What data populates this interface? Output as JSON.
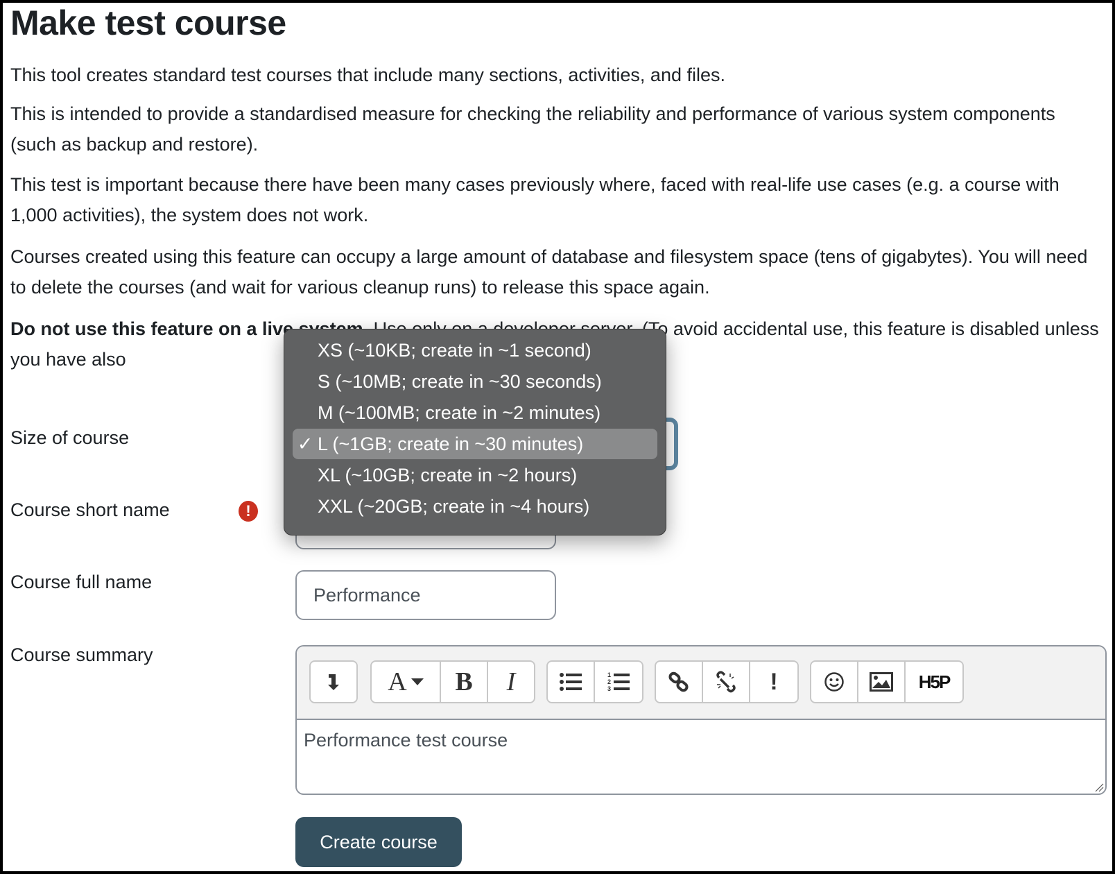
{
  "page": {
    "title": "Make test course",
    "paragraphs": [
      "This tool creates standard test courses that include many sections, activities, and files.",
      "This is intended to provide a standardised measure for checking the reliability and performance of various system components (such as backup and restore).",
      "This test is important because there have been many cases previously where, faced with real-life use cases (e.g. a course with 1,000 activities), the system does not work.",
      "Courses created using this feature can occupy a large amount of database and filesystem space (tens of gigabytes). You will need to delete the courses (and wait for various cleanup runs) to release this space again."
    ],
    "warning_bold": "Do not use this feature on a live system.",
    "warning_rest": " Use only on a developer server. (To avoid accidental use, this feature is disabled unless you have also"
  },
  "form": {
    "size_label": "Size of course",
    "size_selected": "L (~1GB; create in ~30 minutes)",
    "size_options": [
      {
        "label": "XS (~10KB; create in ~1 second)",
        "selected": false
      },
      {
        "label": "S (~10MB; create in ~30 seconds)",
        "selected": false
      },
      {
        "label": "M (~100MB; create in ~2 minutes)",
        "selected": false
      },
      {
        "label": "L (~1GB; create in ~30 minutes)",
        "selected": true
      },
      {
        "label": "XL (~10GB; create in ~2 hours)",
        "selected": false
      },
      {
        "label": "XXL (~20GB; create in ~4 hours)",
        "selected": false
      }
    ],
    "check_mark": "✓",
    "shortname_label": "Course short name",
    "shortname_value": "",
    "required_icon": "!",
    "fullname_label": "Course full name",
    "fullname_value": "Performance",
    "summary_label": "Course summary",
    "summary_value": "Performance test course",
    "toolbar": {
      "groups": [
        [
          "collapse-icon"
        ],
        [
          "text-style-icon",
          "bold-icon",
          "italic-icon"
        ],
        [
          "unordered-list-icon",
          "ordered-list-icon"
        ],
        [
          "link-icon",
          "unlink-icon",
          "accessibility-checker-icon"
        ],
        [
          "emoji-icon",
          "image-icon",
          "h5p-icon"
        ]
      ],
      "text_style_label": "A",
      "bold_label": "B",
      "italic_label": "I",
      "exclaim_label": "!",
      "h5p_label": "H5P"
    },
    "submit_label": "Create course"
  }
}
